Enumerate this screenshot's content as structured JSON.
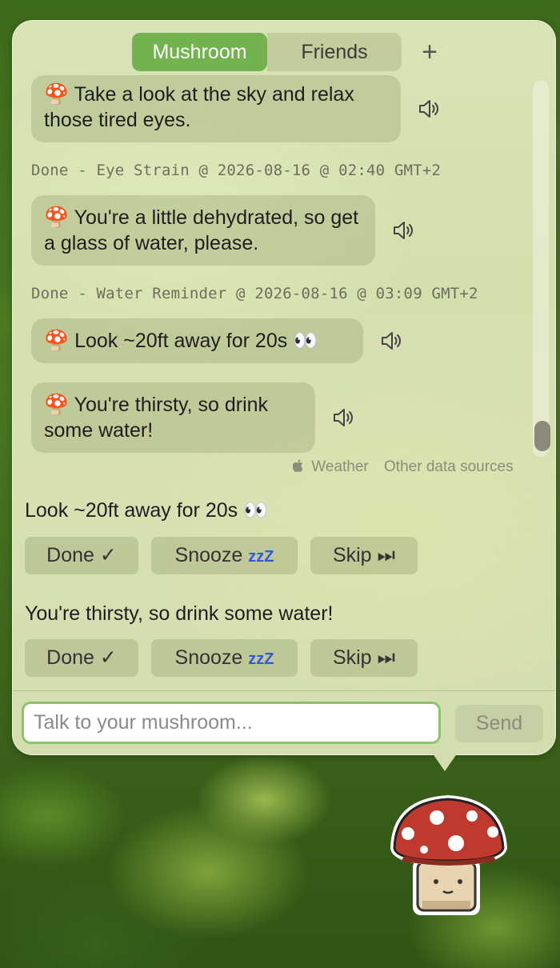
{
  "tabs": [
    {
      "label": "Mushroom",
      "active": true
    },
    {
      "label": "Friends",
      "active": false
    }
  ],
  "tab_add_label": "+",
  "messages": [
    {
      "emoji": "🍄",
      "text": "Take a look at the sky and relax those tired eyes."
    },
    {
      "emoji": "🍄",
      "text": "You're a little dehydrated, so get a glass of water, please."
    },
    {
      "emoji": "🍄",
      "text": "Look ~20ft away for 20s 👀"
    },
    {
      "emoji": "🍄",
      "text": "You're thirsty, so drink some water!"
    }
  ],
  "meta": [
    "Done - Eye Strain @ 2026-08-16 @ 02:40 GMT+2",
    "Done - Water Reminder @ 2026-08-16 @ 03:09 GMT+2"
  ],
  "attribution": {
    "apple": "",
    "weather": "Weather",
    "other": "Other data sources"
  },
  "tasks": [
    {
      "title": "Look ~20ft away for 20s 👀",
      "done": "Done ✓",
      "snooze": "Snooze",
      "snooze_zzz": "zzZ",
      "skip": "Skip ⏭"
    },
    {
      "title": "You're thirsty, so drink some water!",
      "done": "Done ✓",
      "snooze": "Snooze",
      "snooze_zzz": "zzZ",
      "skip": "Skip ⏭"
    }
  ],
  "input": {
    "placeholder": "Talk to your mushroom...",
    "value": ""
  },
  "send_label": "Send",
  "colors": {
    "accent": "#72b34f",
    "input_border": "#8dc46b",
    "zzz": "#2f5bd6"
  }
}
